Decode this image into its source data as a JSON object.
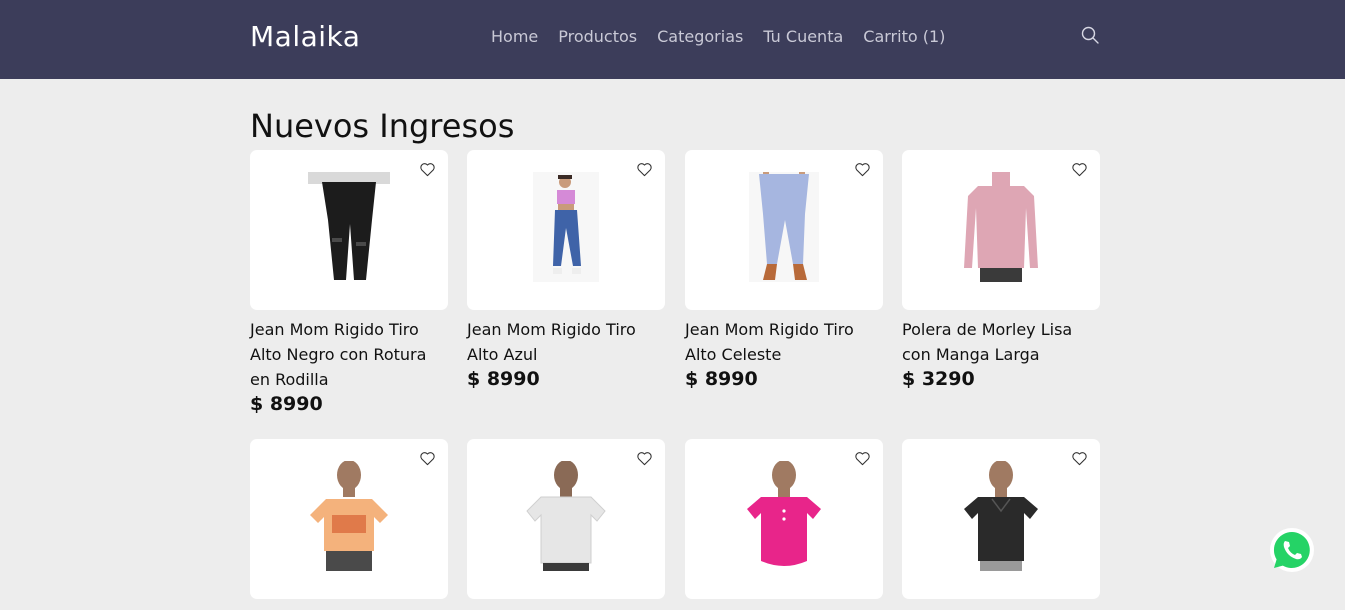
{
  "header": {
    "brand": "Malaika",
    "nav": [
      {
        "label": "Home"
      },
      {
        "label": "Productos"
      },
      {
        "label": "Categorias"
      },
      {
        "label": "Tu Cuenta"
      },
      {
        "label": "Carrito (1)"
      }
    ],
    "search_icon": "search-icon"
  },
  "main": {
    "title": "Nuevos Ingresos",
    "products": [
      {
        "name": "Jean Mom Rigido Tiro Alto Negro con Rotura en Rodilla",
        "price": "$ 8990",
        "kind": "jeans",
        "color": "#1c1c1c"
      },
      {
        "name": "Jean Mom Rigido Tiro Alto Azul",
        "price": "$ 8990",
        "kind": "model",
        "color": "#3f63a8"
      },
      {
        "name": "Jean Mom Rigido Tiro Alto Celeste",
        "price": "$ 8990",
        "kind": "jeans",
        "color": "#a6b6e0"
      },
      {
        "name": "Polera de Morley Lisa con Manga Larga",
        "price": "$ 3290",
        "kind": "longsleeve",
        "color": "#dea6b4"
      },
      {
        "name": "",
        "price": "",
        "kind": "tee",
        "color": "#f4b27c"
      },
      {
        "name": "",
        "price": "",
        "kind": "tee",
        "color": "#e6e6e6"
      },
      {
        "name": "",
        "price": "",
        "kind": "tee",
        "color": "#e8258a"
      },
      {
        "name": "",
        "price": "",
        "kind": "tee",
        "color": "#2a2a2a"
      }
    ]
  },
  "colors": {
    "header_bg": "#3c3d5a",
    "page_bg": "#ededed",
    "whatsapp": "#25d366"
  },
  "floating": {
    "icon": "whatsapp-icon"
  }
}
